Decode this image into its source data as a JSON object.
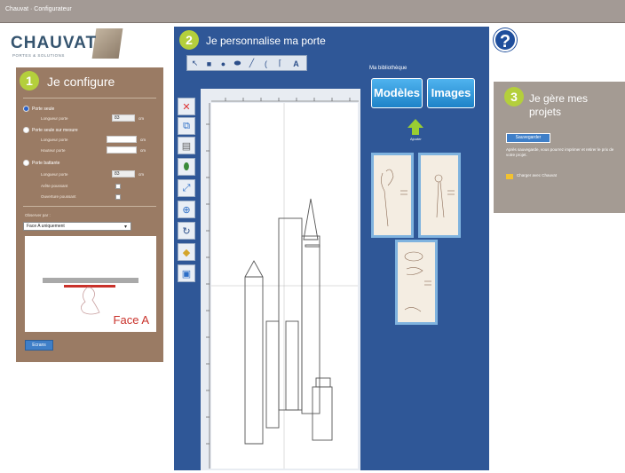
{
  "window": {
    "title": "Chauvat · Configurateur"
  },
  "brand": {
    "name": "CHAUVAT",
    "tagline": "Portes & Solutions"
  },
  "panel1": {
    "number": "1",
    "title": "Je configure",
    "options": [
      {
        "label": "Porte seule",
        "fields": [
          {
            "label": "Longueur porte",
            "value": "83",
            "unit": "cm"
          }
        ]
      },
      {
        "label": "Porte seule sur mesure",
        "fields": [
          {
            "label": "Longueur porte",
            "value": "",
            "unit": "cm"
          },
          {
            "label": "Hauteur porte",
            "value": "",
            "unit": "cm"
          }
        ]
      },
      {
        "label": "Porte battante",
        "fields": [
          {
            "label": "Longueur porte",
            "value": "83",
            "unit": "cm"
          }
        ],
        "checks": [
          "Arête poussant",
          "Ouverture poussant"
        ]
      }
    ],
    "face_label": "Observer par :",
    "face_select": "Face A uniquement",
    "preview_caption": "Face A",
    "apply_button": "Ecrans"
  },
  "panel2": {
    "number": "2",
    "title": "Je personnalise ma porte",
    "library_label": "Ma bibliothèque",
    "btn_models": "Modèles",
    "btn_images": "Images",
    "arrow_caption": "Ajouter"
  },
  "panel3": {
    "number": "3",
    "title_line1": "Je gère mes",
    "title_line2": "projets",
    "save_button": "Sauvegarder",
    "description": "Après sauvegarde, vous pourrez imprimer et retirer le prix de votre projet.",
    "load_link": "Charger avec Chauvat"
  },
  "help": {
    "icon": "?"
  },
  "colors": {
    "panel1": "#9a7b64",
    "panel2": "#2f5797",
    "panel3": "#a49b93",
    "step_badge": "#b4cf3c",
    "accent_blue": "#1e83c8"
  }
}
